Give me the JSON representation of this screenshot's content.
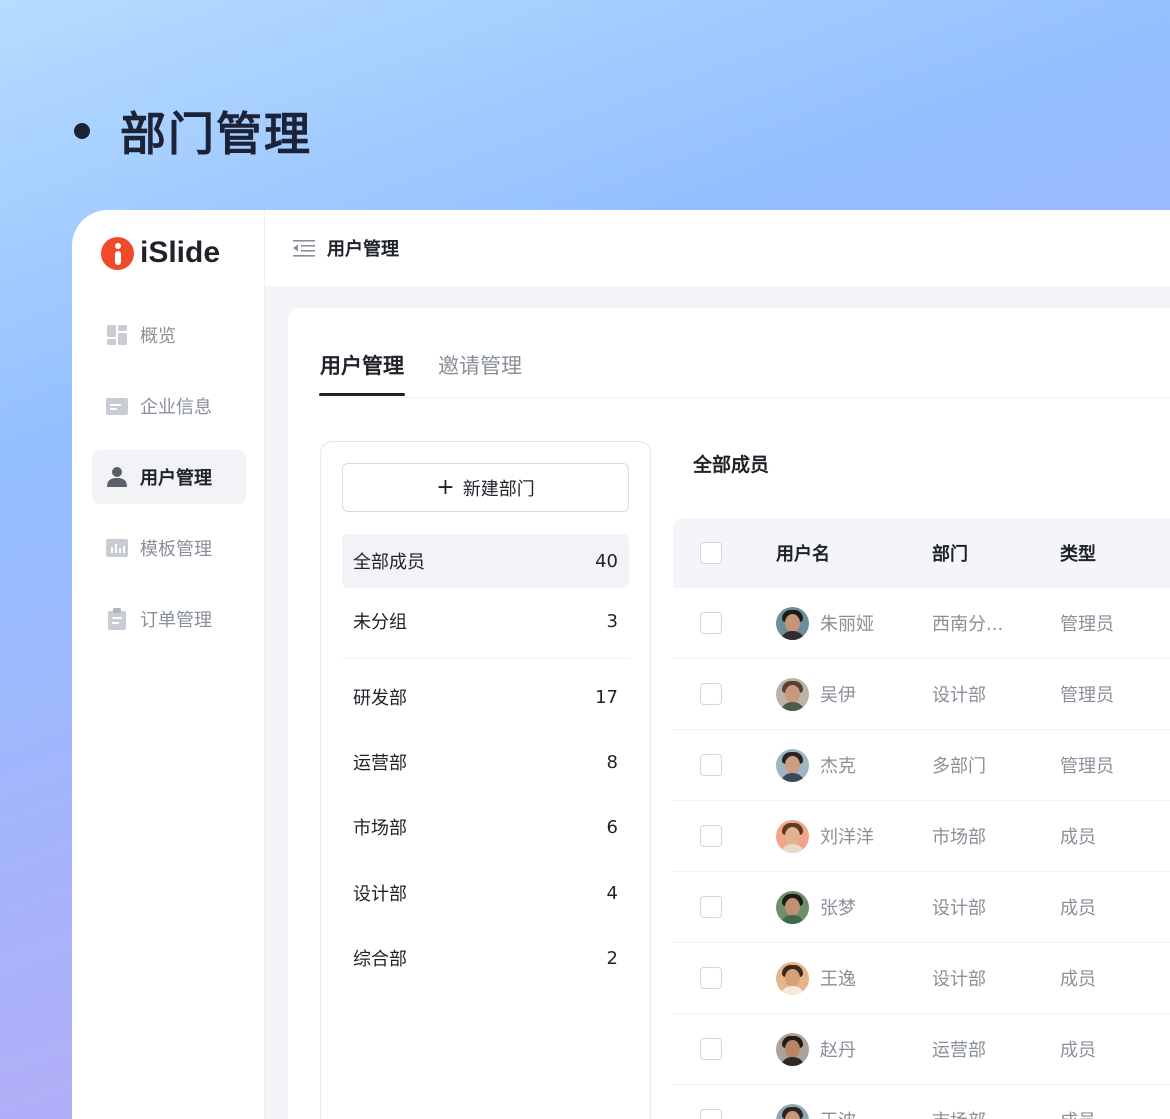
{
  "heading": {
    "title": "部门管理"
  },
  "brand": {
    "name": "iSlide"
  },
  "sidebar": {
    "items": [
      {
        "label": "概览",
        "icon": "dashboard-icon"
      },
      {
        "label": "企业信息",
        "icon": "card-icon"
      },
      {
        "label": "用户管理",
        "icon": "user-icon",
        "active": true
      },
      {
        "label": "模板管理",
        "icon": "chart-icon"
      },
      {
        "label": "订单管理",
        "icon": "clipboard-icon"
      }
    ]
  },
  "topbar": {
    "title": "用户管理"
  },
  "tabs": [
    {
      "label": "用户管理",
      "active": true
    },
    {
      "label": "邀请管理",
      "active": false
    }
  ],
  "departments": {
    "new_button": "新建部门",
    "items": [
      {
        "name": "全部成员",
        "count": "40",
        "active": true
      },
      {
        "name": "未分组",
        "count": "3"
      },
      {
        "name": "研发部",
        "count": "17"
      },
      {
        "name": "运营部",
        "count": "8"
      },
      {
        "name": "市场部",
        "count": "6"
      },
      {
        "name": "设计部",
        "count": "4"
      },
      {
        "name": "综合部",
        "count": "2"
      }
    ]
  },
  "members": {
    "title": "全部成员",
    "columns": {
      "name": "用户名",
      "dept": "部门",
      "type": "类型"
    },
    "rows": [
      {
        "name": "朱丽娅",
        "dept": "西南分...",
        "type": "管理员"
      },
      {
        "name": "吴伊",
        "dept": "设计部",
        "type": "管理员"
      },
      {
        "name": "杰克",
        "dept": "多部门",
        "type": "管理员"
      },
      {
        "name": "刘洋洋",
        "dept": "市场部",
        "type": "成员"
      },
      {
        "name": "张梦",
        "dept": "设计部",
        "type": "成员"
      },
      {
        "name": "王逸",
        "dept": "设计部",
        "type": "成员"
      },
      {
        "name": "赵丹",
        "dept": "运营部",
        "type": "成员"
      },
      {
        "name": "王波",
        "dept": "市场部",
        "type": "成员"
      }
    ]
  },
  "colors": {
    "accent": "#1f2329",
    "brand": "#f04a2a",
    "muted_text": "#8a9099"
  }
}
